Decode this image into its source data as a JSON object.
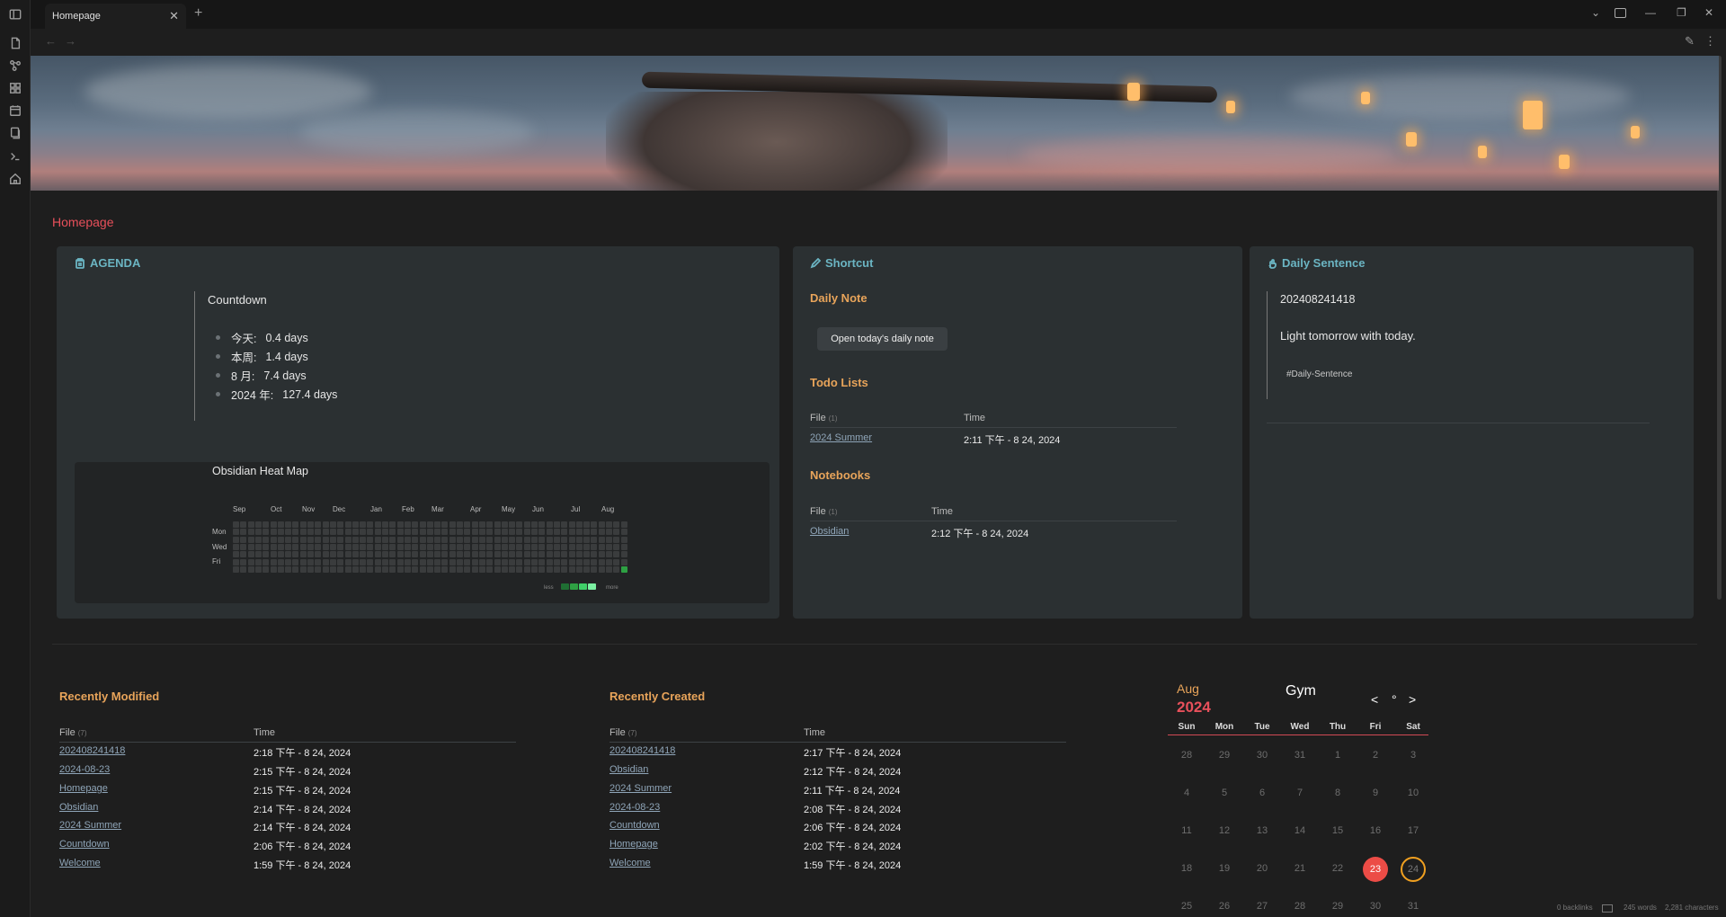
{
  "tab": {
    "title": "Homepage",
    "close": "✕",
    "add": "+"
  },
  "window": {
    "chevron": "⌄",
    "minimize": "—",
    "restore": "❐",
    "close": "✕"
  },
  "nav": {
    "back": "←",
    "forward": "→",
    "edit": "✎",
    "more": "⋮"
  },
  "page": {
    "title": "Homepage"
  },
  "agenda": {
    "title": "AGENDA",
    "countdown_title": "Countdown",
    "items": [
      {
        "label": "今天:",
        "value": "0.4 days"
      },
      {
        "label": "本周:",
        "value": "1.4 days"
      },
      {
        "label": "8 月:",
        "value": "7.4 days"
      },
      {
        "label": "2024 年:",
        "value": "127.4 days"
      }
    ],
    "heatmap": {
      "title": "Obsidian Heat Map",
      "months": [
        "Sep",
        "Oct",
        "Nov",
        "Dec",
        "Jan",
        "Feb",
        "Mar",
        "Apr",
        "May",
        "Jun",
        "Jul",
        "Aug"
      ],
      "days": [
        "Mon",
        "Wed",
        "Fri"
      ],
      "legend_less": "less",
      "legend_more": "more",
      "active_color": "#2ea043",
      "legend_colors": [
        "#1f6f33",
        "#2ea043",
        "#3fcf68",
        "#7bf0a2"
      ]
    }
  },
  "shortcut": {
    "title": "Shortcut",
    "daily_note_title": "Daily Note",
    "open_button": "Open today's daily note",
    "todo_title": "Todo Lists",
    "todo_header": {
      "file": "File",
      "count": "(1)",
      "time": "Time"
    },
    "todo_rows": [
      {
        "file": "2024 Summer",
        "time": "2:11 下午 - 8 24, 2024"
      }
    ],
    "notebooks_title": "Notebooks",
    "notebooks_header": {
      "file": "File",
      "count": "(1)",
      "time": "Time"
    },
    "notebooks_rows": [
      {
        "file": "Obsidian",
        "time": "2:12 下午 - 8 24, 2024"
      }
    ]
  },
  "daily_sentence": {
    "title": "Daily Sentence",
    "id": "202408241418",
    "text": "Light tomorrow with today.",
    "tag": "#Daily-Sentence"
  },
  "recently_modified": {
    "title": "Recently Modified",
    "header": {
      "file": "File",
      "count": "(7)",
      "time": "Time"
    },
    "rows": [
      {
        "file": "202408241418",
        "time": "2:18 下午 - 8 24, 2024"
      },
      {
        "file": "2024-08-23",
        "time": "2:15 下午 - 8 24, 2024"
      },
      {
        "file": "Homepage",
        "time": "2:15 下午 - 8 24, 2024"
      },
      {
        "file": "Obsidian",
        "time": "2:14 下午 - 8 24, 2024"
      },
      {
        "file": "2024 Summer",
        "time": "2:14 下午 - 8 24, 2024"
      },
      {
        "file": "Countdown",
        "time": "2:06 下午 - 8 24, 2024"
      },
      {
        "file": "Welcome",
        "time": "1:59 下午 - 8 24, 2024"
      }
    ]
  },
  "recently_created": {
    "title": "Recently Created",
    "header": {
      "file": "File",
      "count": "(7)",
      "time": "Time"
    },
    "rows": [
      {
        "file": "202408241418",
        "time": "2:17 下午 - 8 24, 2024"
      },
      {
        "file": "Obsidian",
        "time": "2:12 下午 - 8 24, 2024"
      },
      {
        "file": "2024 Summer",
        "time": "2:11 下午 - 8 24, 2024"
      },
      {
        "file": "2024-08-23",
        "time": "2:08 下午 - 8 24, 2024"
      },
      {
        "file": "Countdown",
        "time": "2:06 下午 - 8 24, 2024"
      },
      {
        "file": "Homepage",
        "time": "2:02 下午 - 8 24, 2024"
      },
      {
        "file": "Welcome",
        "time": "1:59 下午 - 8 24, 2024"
      }
    ]
  },
  "calendar": {
    "month": "Aug",
    "year": "2024",
    "title": "Gym",
    "prev": "<",
    "today_dot": "°",
    "next": ">",
    "weekdays": [
      "Sun",
      "Mon",
      "Tue",
      "Wed",
      "Thu",
      "Fri",
      "Sat"
    ],
    "weeks": [
      [
        "28",
        "29",
        "30",
        "31",
        "1",
        "2",
        "3"
      ],
      [
        "4",
        "5",
        "6",
        "7",
        "8",
        "9",
        "10"
      ],
      [
        "11",
        "12",
        "13",
        "14",
        "15",
        "16",
        "17"
      ],
      [
        "18",
        "19",
        "20",
        "21",
        "22",
        "23",
        "24"
      ],
      [
        "25",
        "26",
        "27",
        "28",
        "29",
        "30",
        "31"
      ]
    ],
    "today": "23",
    "selected": "24",
    "today_color": "#ec4c46",
    "selected_color": "#f0a020"
  },
  "status": {
    "backlinks": "0 backlinks",
    "words": "245 words",
    "chars": "2,281 characters"
  }
}
